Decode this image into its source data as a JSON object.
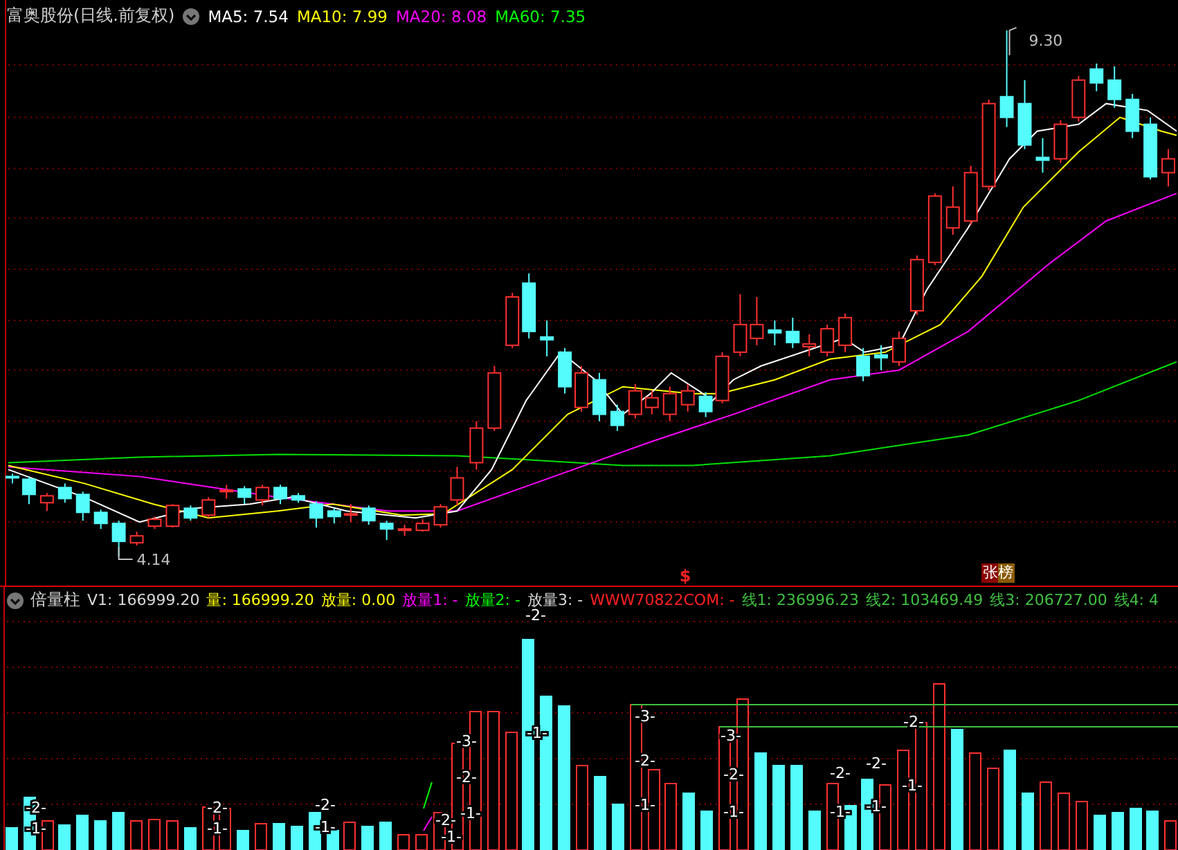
{
  "price_panel": {
    "title": "富奥股份(日线.前复权)",
    "indicators": [
      {
        "label": "MA5: 7.54",
        "color": "#ffffff"
      },
      {
        "label": "MA10: 7.99",
        "color": "#ffff00"
      },
      {
        "label": "MA20: 8.08",
        "color": "#ff00ff"
      },
      {
        "label": "MA60: 7.35",
        "color": "#00ff00"
      }
    ],
    "high_label": "9.30",
    "low_label": "4.14",
    "signal_mark": "$",
    "badge": "张榜"
  },
  "volume_panel": {
    "title": "倍量柱",
    "readings": [
      {
        "label": "V1: 166999.20",
        "color": "#d8d8d8"
      },
      {
        "label": "量: 166999.20",
        "color": "#ffff00"
      },
      {
        "label": "放量: 0.00",
        "color": "#ffff00"
      },
      {
        "label": "放量1: -",
        "color": "#ff00ff"
      },
      {
        "label": "放量2: -",
        "color": "#00ff00"
      },
      {
        "label": "放量3: -",
        "color": "#d8d8d8"
      },
      {
        "label": "WWW70822COM: -",
        "color": "#ff2020"
      },
      {
        "label": "线1: 236996.23",
        "color": "#40c040"
      },
      {
        "label": "线2: 103469.49",
        "color": "#40c040"
      },
      {
        "label": "线3: 206727.00",
        "color": "#40c040"
      },
      {
        "label": "线4: 4",
        "color": "#40c040"
      }
    ],
    "bar_marks": [
      "-2-",
      "-1-",
      "-2-",
      "-1-",
      "-2-",
      "-1-",
      "-3-",
      "-2-",
      "-1-",
      "-2-",
      "-1-",
      "-2-",
      "-1-",
      "-3-",
      "-2-",
      "-1-",
      "-3-",
      "-2-",
      "-1-",
      "-2-",
      "-1-",
      "-2-",
      "-1-",
      "-2-",
      "-1-"
    ]
  }
}
